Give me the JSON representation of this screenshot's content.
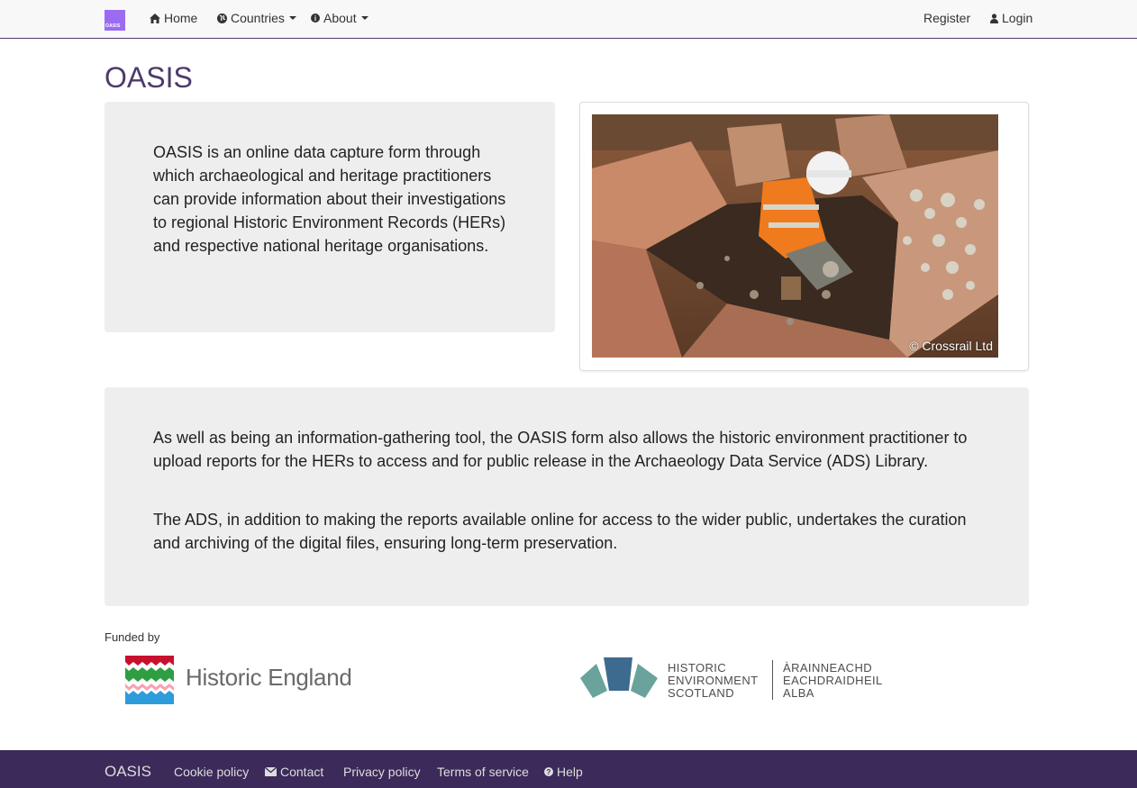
{
  "navbar": {
    "brand_text": "OASIS",
    "home": "Home",
    "countries": "Countries",
    "about": "About",
    "register": "Register",
    "login": "Login"
  },
  "main": {
    "title": "OASIS",
    "intro": "OASIS is an online data capture form through which archaeological and heritage practitioners can provide information about their investigations to regional Historic Environment Records (HERs) and respective national heritage organisations.",
    "photo_credit": "© Crossrail Ltd",
    "para1": "As well as being an information-gathering tool, the OASIS form also allows the historic environment practitioner to upload reports for the HERs to access and for public release in the Archaeology Data Service (ADS) Library.",
    "para2": "The ADS, in addition to making the reports available online for access to the wider public, undertakes the curation and archiving of the digital files, ensuring long-term preservation."
  },
  "funders": {
    "label": "Funded by",
    "historic_england": "Historic England",
    "hes_english": [
      "HISTORIC",
      "ENVIRONMENT",
      "SCOTLAND"
    ],
    "hes_gaelic": [
      "ÀRAINNEACHD",
      "EACHDRAIDHEIL",
      "ALBA"
    ]
  },
  "footer": {
    "brand": "OASIS",
    "cookie": "Cookie policy",
    "contact": "Contact",
    "privacy": "Privacy policy",
    "terms": "Terms of service",
    "help": "Help"
  },
  "colors": {
    "brand_purple": "#4e3a6b",
    "footer_bg": "#3b2a5a",
    "well_bg": "#eeeeee"
  }
}
